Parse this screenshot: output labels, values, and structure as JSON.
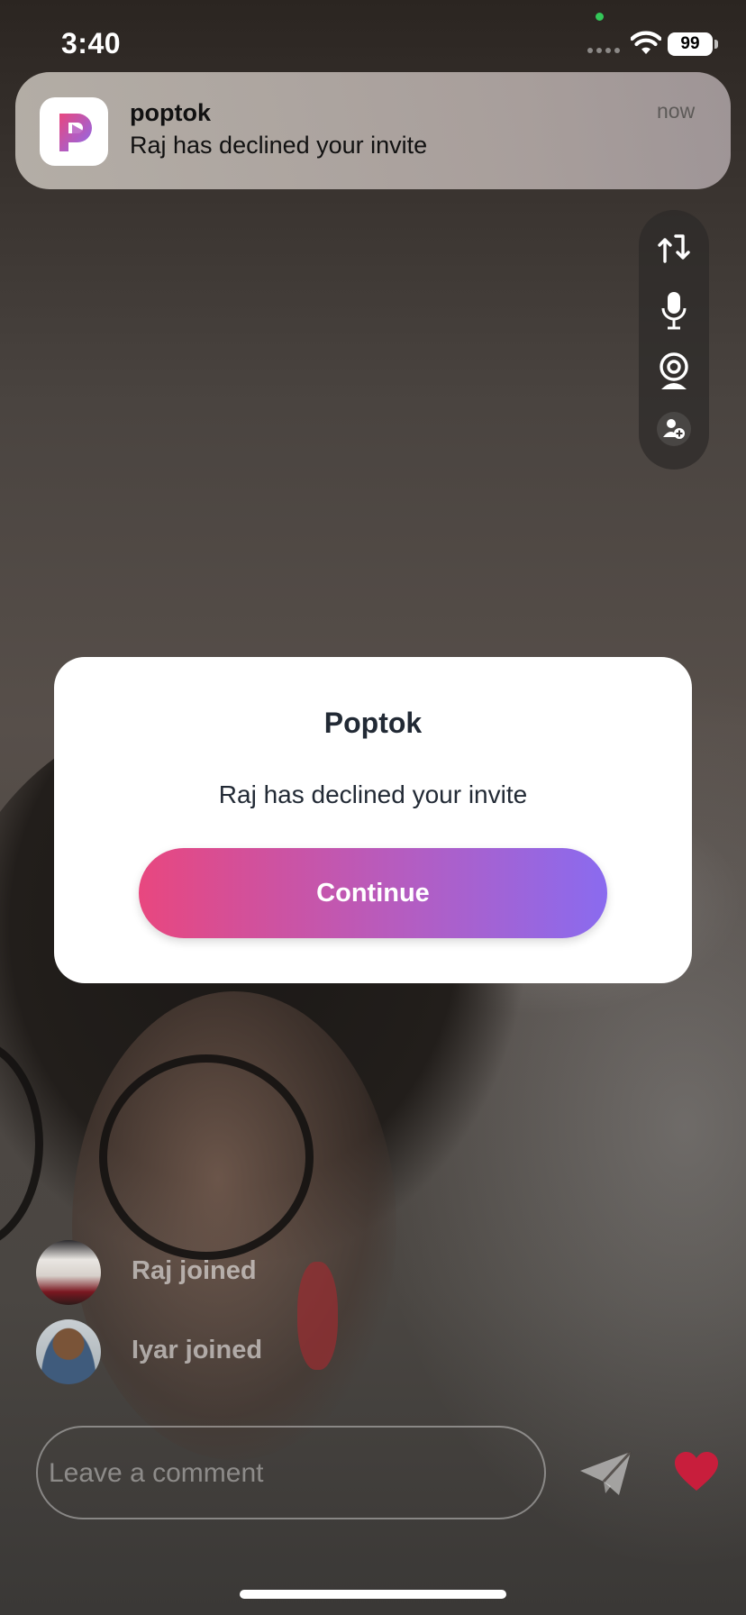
{
  "status_bar": {
    "time": "3:40",
    "battery": "99"
  },
  "notification": {
    "app": "poptok",
    "message": "Raj has declined your invite",
    "time": "now"
  },
  "side_controls": [
    "switch-camera-icon",
    "microphone-icon",
    "webcam-icon",
    "add-guest-icon"
  ],
  "dialog": {
    "title": "Poptok",
    "message": "Raj has declined your invite",
    "button_label": "Continue"
  },
  "join_events": [
    {
      "text": "Raj joined"
    },
    {
      "text": "Iyar joined"
    }
  ],
  "comment": {
    "placeholder": "Leave a comment"
  },
  "colors": {
    "accent_start": "#e8477f",
    "accent_end": "#8a6bef",
    "heart": "#c81e3c"
  }
}
